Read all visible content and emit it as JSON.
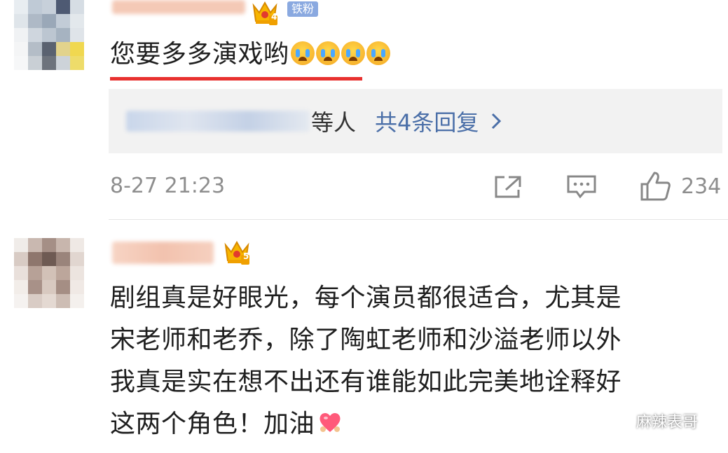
{
  "comments": [
    {
      "badge": "铁粉",
      "crown_level": "4",
      "text": "您要多多演戏哟",
      "replies_suffix": "等人",
      "replies_link": "共4条回复",
      "time": "8-27 21:23",
      "likes": "234"
    },
    {
      "crown_level": "5",
      "lines": [
        "剧组真是好眼光，每个演员都很适合，尤其是",
        "宋老师和老乔，除了陶虹老师和沙溢老师以外",
        "我真是实在想不出还有谁能如此完美地诠释好",
        "这两个角色！加油"
      ]
    }
  ],
  "watermark": "麻辣表哥",
  "colors": {
    "underline": "#e8312f",
    "link": "#4b6fa8",
    "meta": "#8e8e8e",
    "reply_bg": "#f2f2f2"
  }
}
